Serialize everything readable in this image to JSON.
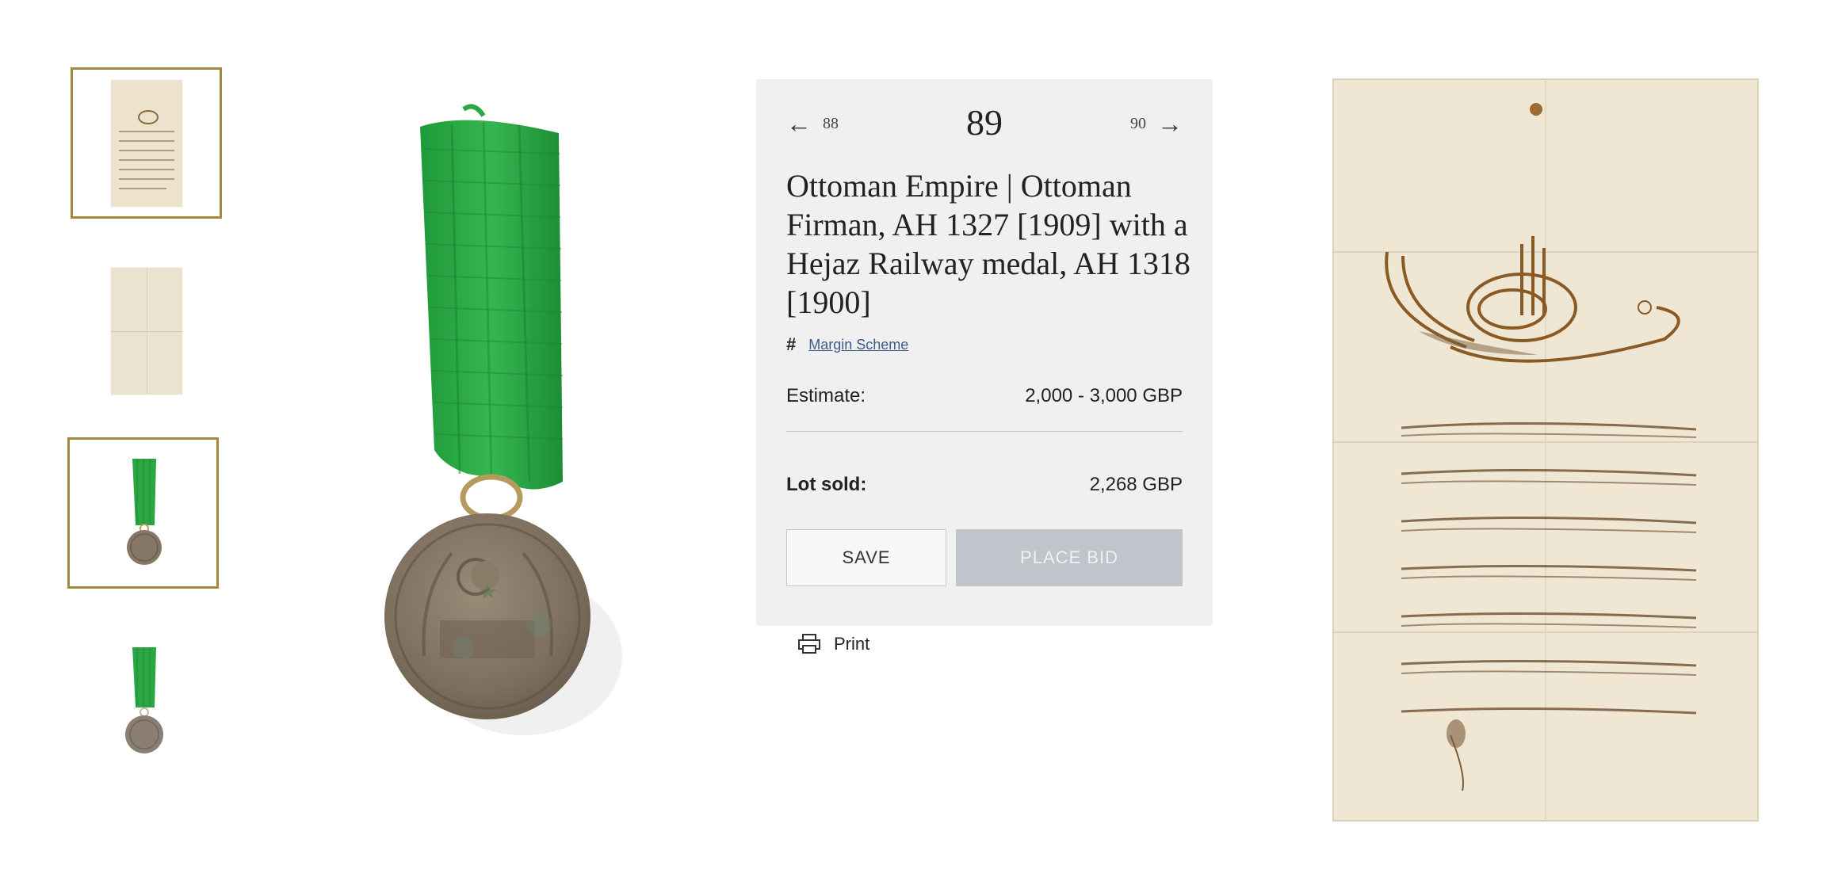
{
  "thumbnails": [
    {
      "name": "firman-front",
      "selected": true
    },
    {
      "name": "firman-back",
      "selected": false
    },
    {
      "name": "medal-ribbon",
      "selected": true
    },
    {
      "name": "medal-ribbon-alt",
      "selected": false
    }
  ],
  "lot": {
    "number": "89",
    "prev": "88",
    "next": "90",
    "title": "Ottoman Empire | Ottoman Firman, AH 1327 [1909] with a Hejaz Railway medal, AH 1318 [1900]",
    "vat_symbol": "#",
    "vat_label": "Margin Scheme",
    "estimate_label": "Estimate:",
    "estimate_value": "2,000 - 3,000 GBP",
    "sold_label": "Lot sold:",
    "sold_value": "2,268 GBP"
  },
  "buttons": {
    "save": "SAVE",
    "place_bid": "PLACE BID"
  },
  "print_label": "Print",
  "colors": {
    "accent_gold": "#a38a3b",
    "panel_bg": "#f0f0f0",
    "ribbon_green": "#27a83f",
    "disabled_button": "#c0c5cb"
  }
}
